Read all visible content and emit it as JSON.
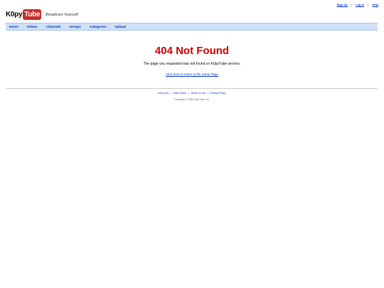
{
  "header": {
    "links": [
      "Sign Up",
      "Log In",
      "Help"
    ],
    "separator": "|",
    "logo_prefix": "K0py",
    "logo_tube": "Tube",
    "tagline": "Broadcast Yourself"
  },
  "nav": {
    "items": [
      "Home",
      "Videos",
      "Channels",
      "Groups",
      "Categories",
      "Upload"
    ]
  },
  "main": {
    "title": "404 Not Found",
    "message": "The page you requested was not found on K0pyTube servers.",
    "home_link": "Click here to return to the Home Page"
  },
  "footer": {
    "links": [
      "About Us",
      "Help Center",
      "Terms of Use",
      "Privacy Policy"
    ],
    "separator": "|",
    "copyright": "Copyright © 2006 K0pyTube, Inc."
  },
  "colors": {
    "error_red": "#cc0000",
    "link_blue": "#0033cc",
    "navbar_bg": "#cfe0f7",
    "logo_red": "#c4302b"
  }
}
